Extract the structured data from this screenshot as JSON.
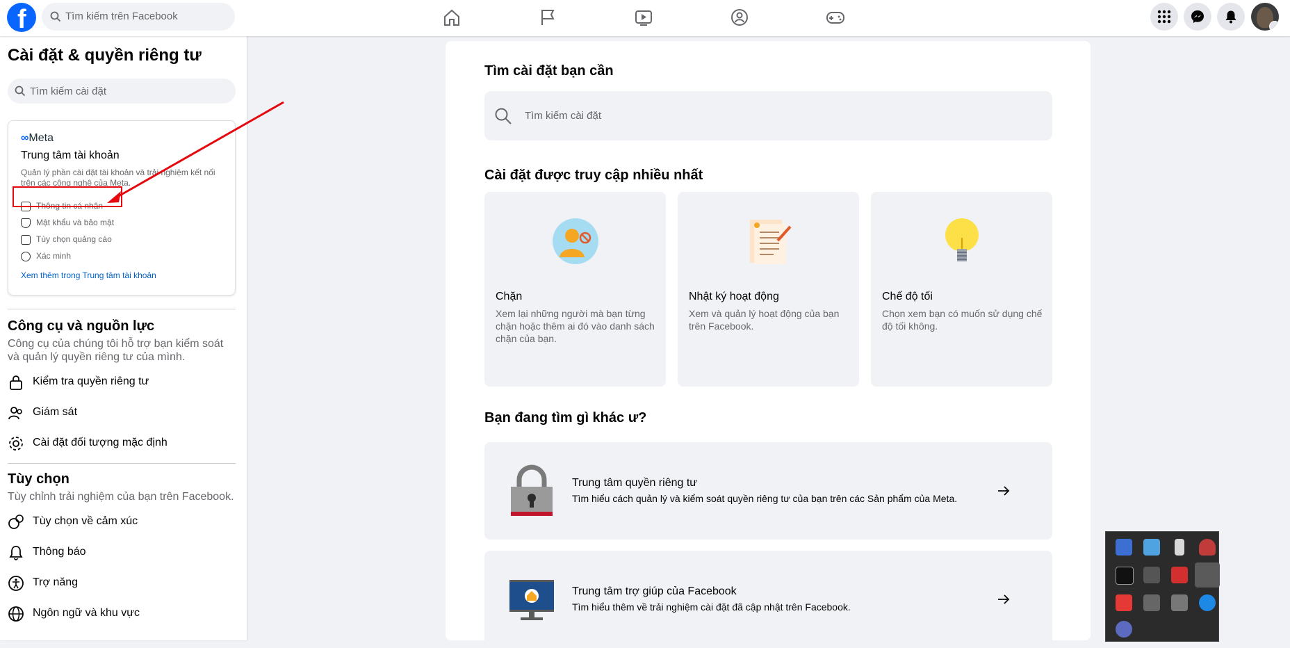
{
  "topbar": {
    "logo": "f",
    "search_placeholder": "Tìm kiếm trên Facebook",
    "nav_icons": [
      "home-icon",
      "flag-icon",
      "video-icon",
      "groups-icon",
      "gaming-icon"
    ],
    "right_icons": [
      "menu-grid-icon",
      "messenger-icon",
      "notifications-icon"
    ]
  },
  "sidebar": {
    "title": "Cài đặt & quyền riêng tư",
    "search_placeholder": "Tìm kiếm cài đặt",
    "account_center": {
      "brand": "Meta",
      "title": "Trung tâm tài khoản",
      "description": "Quản lý phần cài đặt tài khoản và trải nghiệm kết nối trên các công nghệ của Meta.",
      "items": [
        {
          "label": "Thông tin cá nhân",
          "icon": "id-card-icon"
        },
        {
          "label": "Mật khẩu và bảo mật",
          "icon": "shield-icon"
        },
        {
          "label": "Tùy chọn quảng cáo",
          "icon": "ads-icon"
        },
        {
          "label": "Xác minh",
          "icon": "verified-icon"
        }
      ],
      "link": "Xem thêm trong Trung tâm tài khoản"
    },
    "tools": {
      "title": "Công cụ và nguồn lực",
      "description": "Công cụ của chúng tôi hỗ trợ bạn kiểm soát và quản lý quyền riêng tư của mình.",
      "items": [
        {
          "label": "Kiểm tra quyền riêng tư",
          "icon": "lock-icon"
        },
        {
          "label": "Giám sát",
          "icon": "supervision-icon"
        },
        {
          "label": "Cài đặt đối tượng mặc định",
          "icon": "gear-icon"
        }
      ]
    },
    "preferences": {
      "title": "Tùy chọn",
      "description": "Tùy chỉnh trải nghiệm của bạn trên Facebook.",
      "items": [
        {
          "label": "Tùy chọn về cảm xúc",
          "icon": "reactions-icon"
        },
        {
          "label": "Thông báo",
          "icon": "bell-icon"
        },
        {
          "label": "Trợ năng",
          "icon": "accessibility-icon"
        },
        {
          "label": "Ngôn ngữ và khu vực",
          "icon": "globe-icon"
        }
      ]
    }
  },
  "main": {
    "search_title": "Tìm cài đặt bạn cần",
    "search_placeholder": "Tìm kiếm cài đặt",
    "most_visited_title": "Cài đặt được truy cập nhiều nhất",
    "tiles": [
      {
        "title": "Chặn",
        "description": "Xem lại những người mà bạn từng chặn hoặc thêm ai đó vào danh sách chặn của bạn.",
        "icon": "block-person-icon"
      },
      {
        "title": "Nhật ký hoạt động",
        "description": "Xem và quản lý hoạt động của bạn trên Facebook.",
        "icon": "activity-log-icon"
      },
      {
        "title": "Chế độ tối",
        "description": "Chọn xem bạn có muốn sử dụng chế độ tối không.",
        "icon": "lightbulb-icon"
      }
    ],
    "other_title": "Bạn đang tìm gì khác ư?",
    "rows": [
      {
        "title": "Trung tâm quyền riêng tư",
        "description": "Tìm hiểu cách quản lý và kiểm soát quyền riêng tư của bạn trên các Sản phẩm của Meta.",
        "icon": "padlock-icon"
      },
      {
        "title": "Trung tâm trợ giúp của Facebook",
        "description": "Tìm hiểu thêm về trải nghiệm cài đặt đã cập nhật trên Facebook.",
        "icon": "monitor-help-icon"
      }
    ]
  },
  "colors": {
    "brand": "#0866ff",
    "annotation": "#e5090f",
    "link": "#0064d1"
  }
}
